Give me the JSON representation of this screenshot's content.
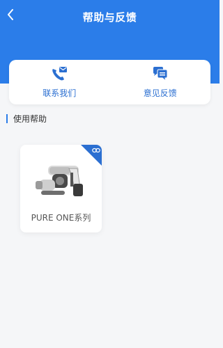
{
  "header": {
    "title": "帮助与反馈",
    "back_icon": "chevron-left-icon",
    "background_color": "#2b7de9"
  },
  "actions": [
    {
      "label": "联系我们",
      "icon": "phone-mail-icon"
    },
    {
      "label": "意见反馈",
      "icon": "chat-bubbles-icon"
    }
  ],
  "section": {
    "title": "使用帮助",
    "accent_color": "#2b7de9"
  },
  "products": [
    {
      "name": "PURE ONE系列",
      "badge_icon": "link-icon"
    }
  ]
}
